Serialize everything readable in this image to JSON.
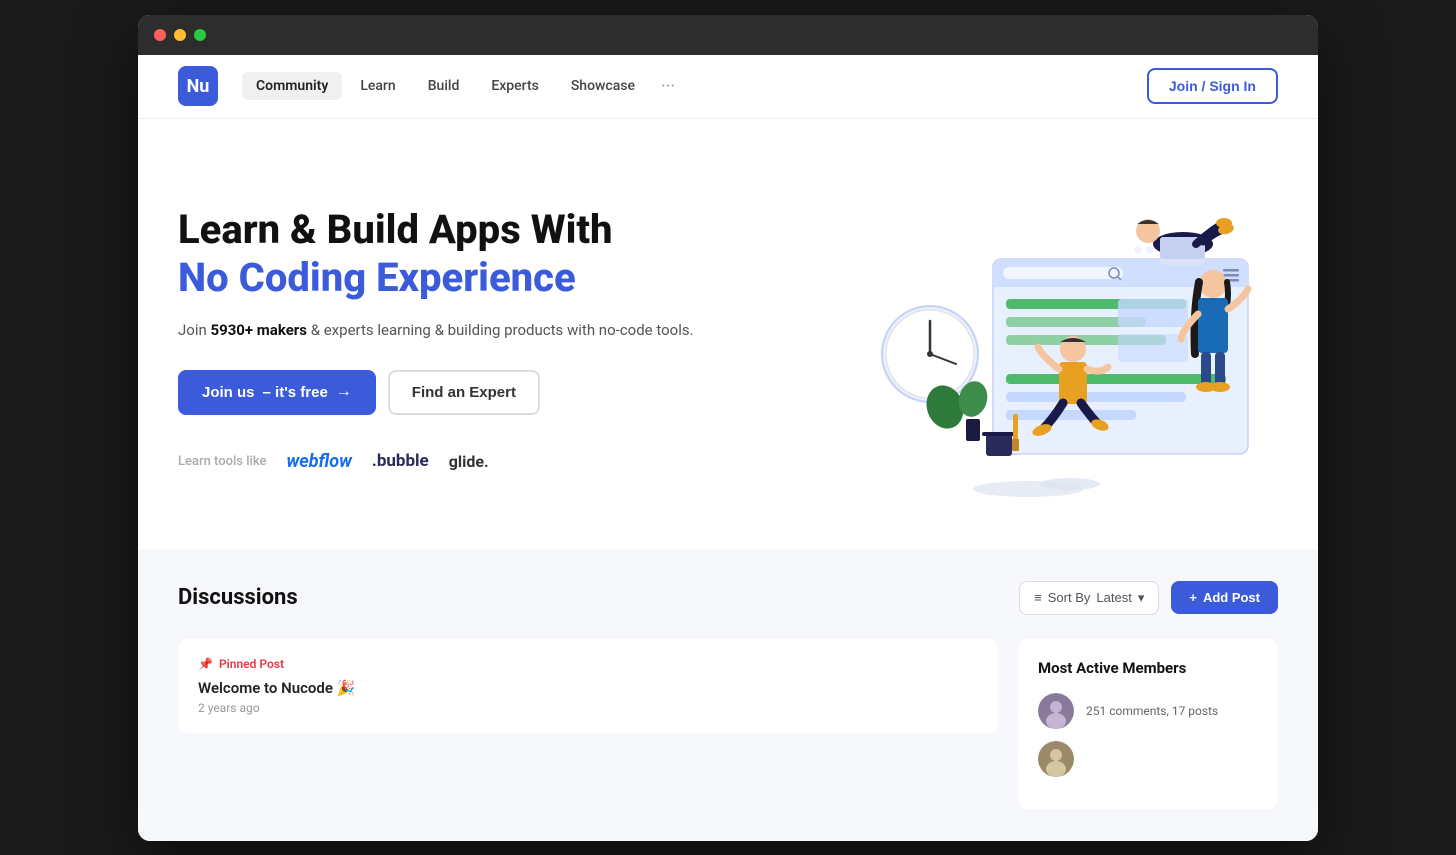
{
  "browser": {
    "dots": [
      "red",
      "yellow",
      "green"
    ]
  },
  "navbar": {
    "logo_text": "Nu",
    "items": [
      {
        "label": "Community",
        "active": true
      },
      {
        "label": "Learn",
        "active": false
      },
      {
        "label": "Build",
        "active": false
      },
      {
        "label": "Experts",
        "active": false
      },
      {
        "label": "Showcase",
        "active": false
      }
    ],
    "more_label": "···",
    "join_label": "Join / Sign In"
  },
  "hero": {
    "title_line1": "Learn & Build Apps With",
    "title_line2": "No Coding Experience",
    "subtitle_start": "Join ",
    "subtitle_bold": "5930+ makers",
    "subtitle_end": " & experts learning & building products with no-code tools.",
    "btn_primary_text": "Join us",
    "btn_primary_sub": "– it's free",
    "btn_primary_arrow": "→",
    "btn_secondary": "Find an Expert",
    "tools_label": "Learn tools like",
    "tool1": "webflow",
    "tool2": ".bubble",
    "tool3": "glide."
  },
  "discussions": {
    "title": "Discussions",
    "sort_label": "Sort By",
    "sort_value": "Latest",
    "sort_icon": "≡",
    "add_icon": "+",
    "add_label": "Add Post",
    "pinned_icon": "📌",
    "pinned_label": "Pinned Post",
    "post_title": "Welcome to Nucode 🎉",
    "post_meta": "2 years ago"
  },
  "sidebar": {
    "title": "Most Active Members",
    "members": [
      {
        "comments": "251 comments, 17 posts"
      }
    ]
  }
}
